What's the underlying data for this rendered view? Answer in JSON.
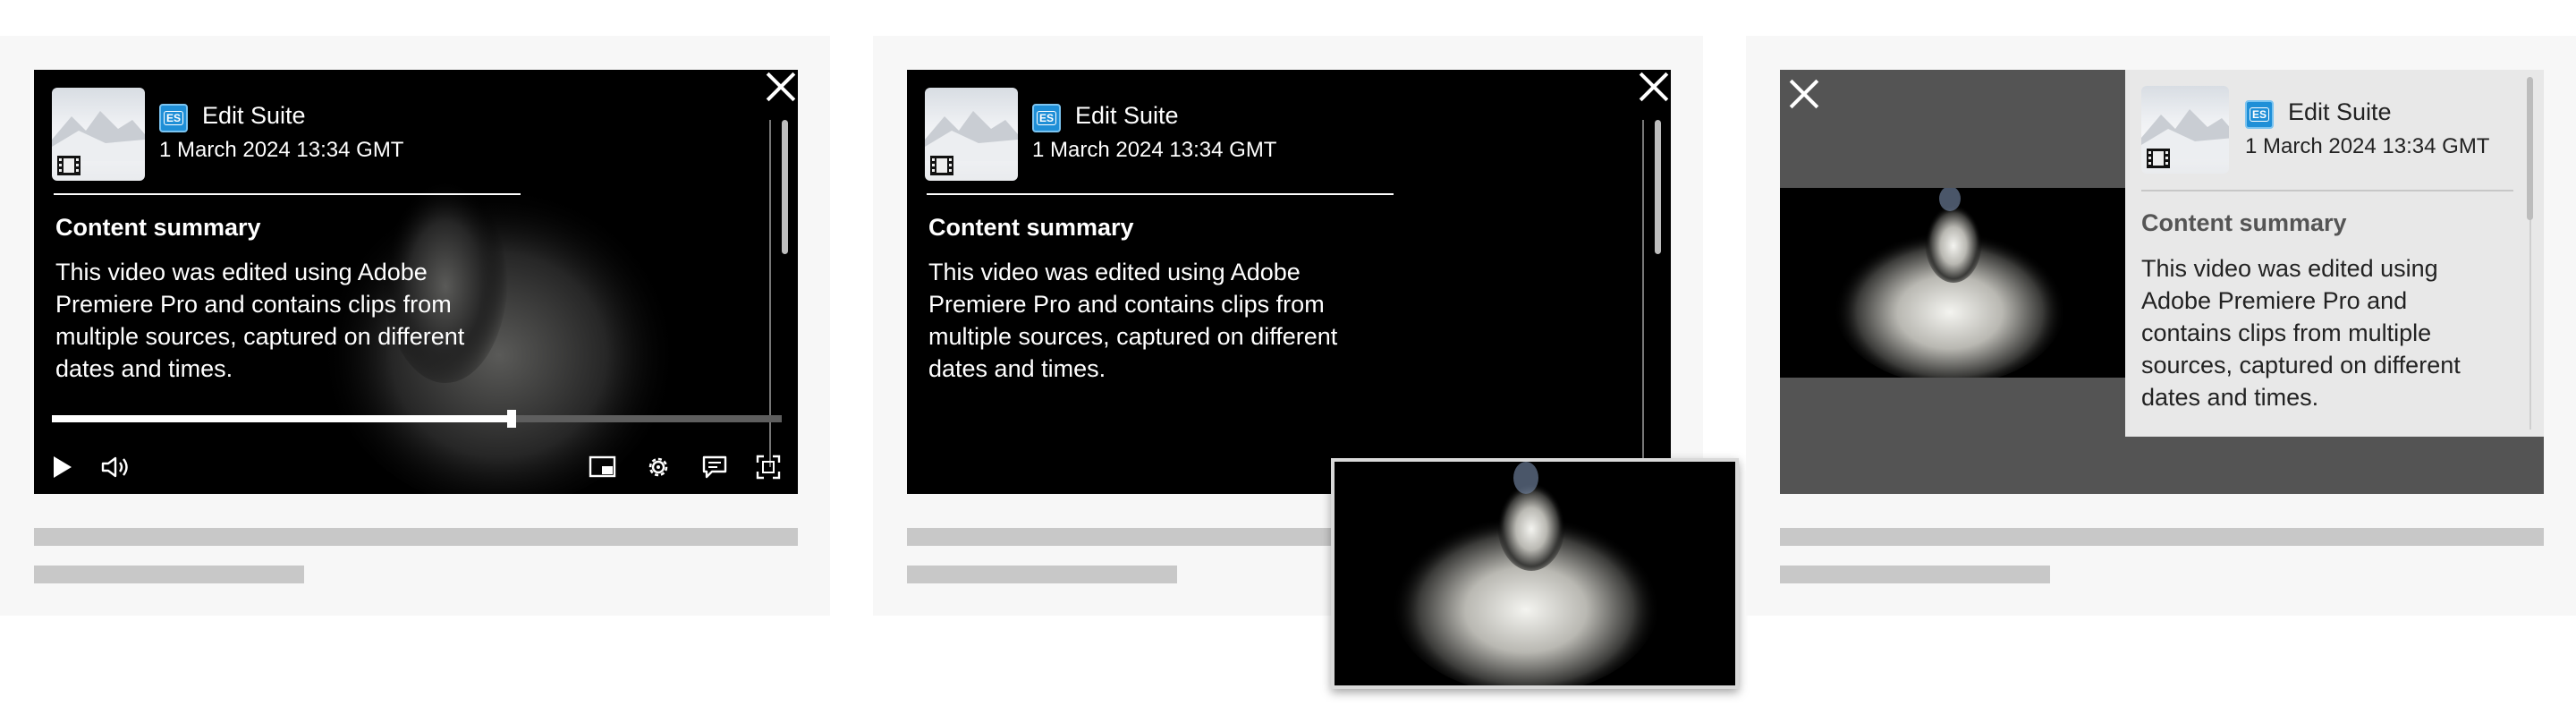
{
  "panels": [
    {
      "app_badge": "ES",
      "app_name": "Edit Suite",
      "date": "1 March 2024 13:34 GMT",
      "summary_title": "Content summary",
      "summary_lines": [
        "This video was edited using Adobe",
        "Premiere Pro and contains clips from",
        "multiple sources, captured on different",
        "dates and times."
      ],
      "progress": 0.63,
      "icons": [
        "close-icon",
        "play-icon",
        "volume-icon",
        "picture-in-picture-icon",
        "gear-icon",
        "captions-icon",
        "fullscreen-icon",
        "film-icon"
      ]
    },
    {
      "app_badge": "ES",
      "app_name": "Edit Suite",
      "date": "1 March 2024 13:34 GMT",
      "summary_title": "Content summary",
      "summary_lines": [
        "This video was edited using Adobe",
        "Premiere Pro and contains clips from",
        "multiple sources, captured on different",
        "dates and times."
      ],
      "icons": [
        "close-icon",
        "film-icon"
      ]
    },
    {
      "app_badge": "ES",
      "app_name": "Edit Suite",
      "date": "1 March 2024 13:34 GMT",
      "summary_title": "Content summary",
      "summary_lines": [
        "This video was edited using",
        "Adobe Premiere Pro and",
        "contains clips from multiple",
        "sources, captured on different",
        "dates and times."
      ],
      "icons": [
        "close-icon",
        "film-icon"
      ]
    }
  ],
  "colors": {
    "badge": "#1f8fd7",
    "card_bg": "#f7f7f7",
    "skeleton": "#c8c8c8",
    "panel_light": "#e8e8e8"
  }
}
